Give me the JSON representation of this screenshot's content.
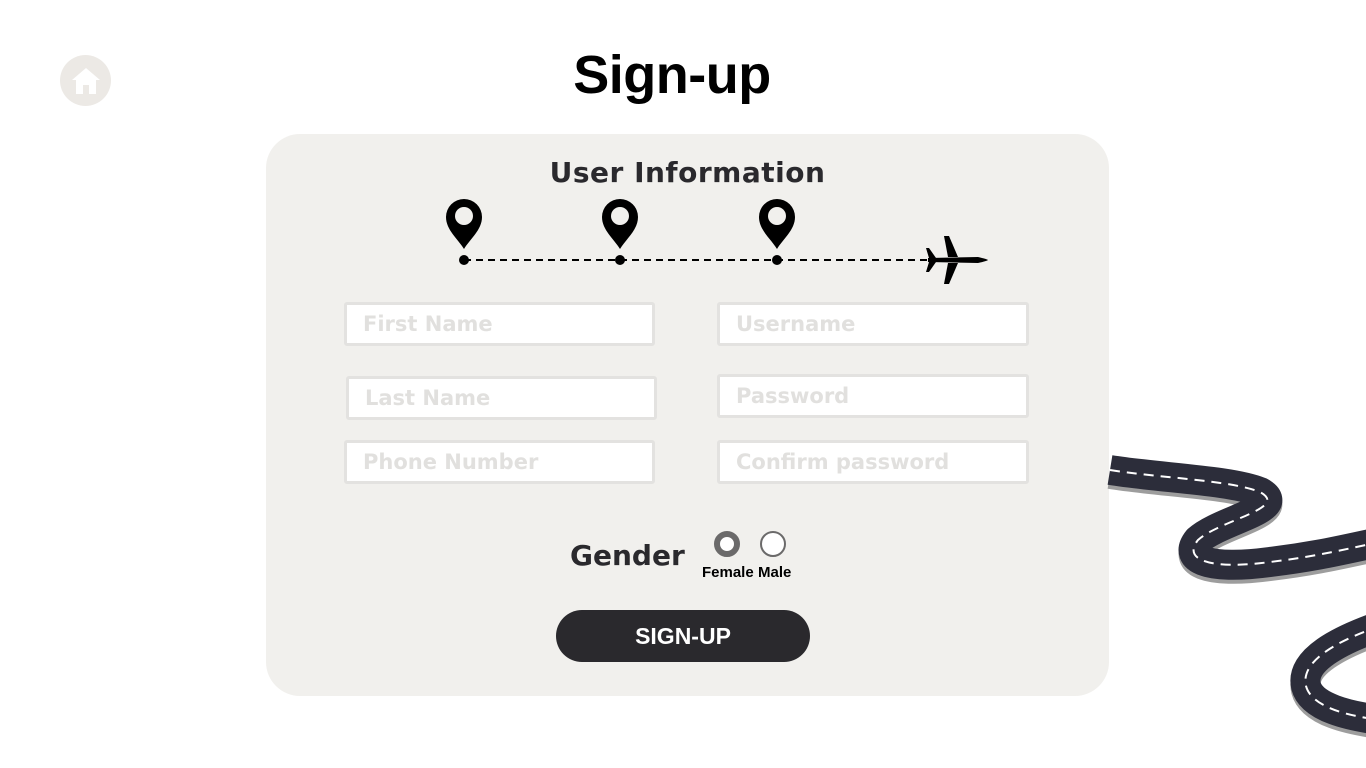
{
  "header": {
    "title": "Sign-up",
    "home_icon": "home-icon"
  },
  "form": {
    "section_title": "User Information",
    "progress": {
      "steps": 3,
      "icon": "location-pin-icon",
      "end_icon": "airplane-icon"
    },
    "fields": {
      "first_name": {
        "placeholder": "First Name",
        "value": ""
      },
      "last_name": {
        "placeholder": "Last Name",
        "value": ""
      },
      "phone_number": {
        "placeholder": "Phone Number",
        "value": ""
      },
      "username": {
        "placeholder": "Username",
        "value": ""
      },
      "password": {
        "placeholder": "Password",
        "value": ""
      },
      "confirm_password": {
        "placeholder": "Confirm password",
        "value": ""
      }
    },
    "gender": {
      "label": "Gender",
      "options": [
        {
          "label": "Female",
          "selected": true
        },
        {
          "label": "Male",
          "selected": false
        }
      ]
    },
    "submit_label": "SIGN-UP"
  },
  "colors": {
    "card_background": "#f1f0ed",
    "dark": "#2a292d",
    "field_border": "#e3e2e0",
    "placeholder": "#e1e0de",
    "home_button": "#ece9e5"
  }
}
